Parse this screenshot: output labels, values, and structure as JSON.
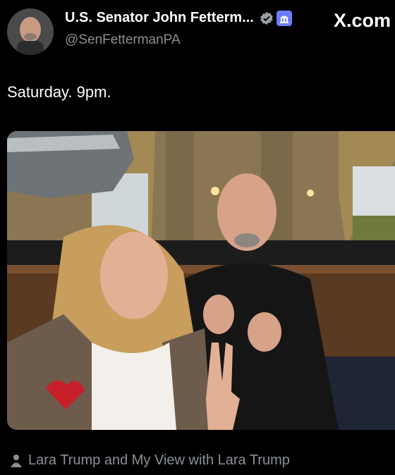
{
  "author": {
    "display_name": "U.S. Senator John Fetterm...",
    "handle": "@SenFettermanPA"
  },
  "brand": {
    "label": "X.com"
  },
  "tweet": {
    "text": "Saturday. 9pm."
  },
  "media": {
    "tag_text": "Lara Trump and My View with Lara Trump"
  },
  "colors": {
    "verified": "#1d9bf0",
    "gov_badge": "#6b7cff",
    "secondary_text": "#8b9096"
  },
  "icons": [
    "avatar",
    "verified-icon",
    "government-badge-icon",
    "x-logo-icon",
    "person-tag-icon"
  ]
}
